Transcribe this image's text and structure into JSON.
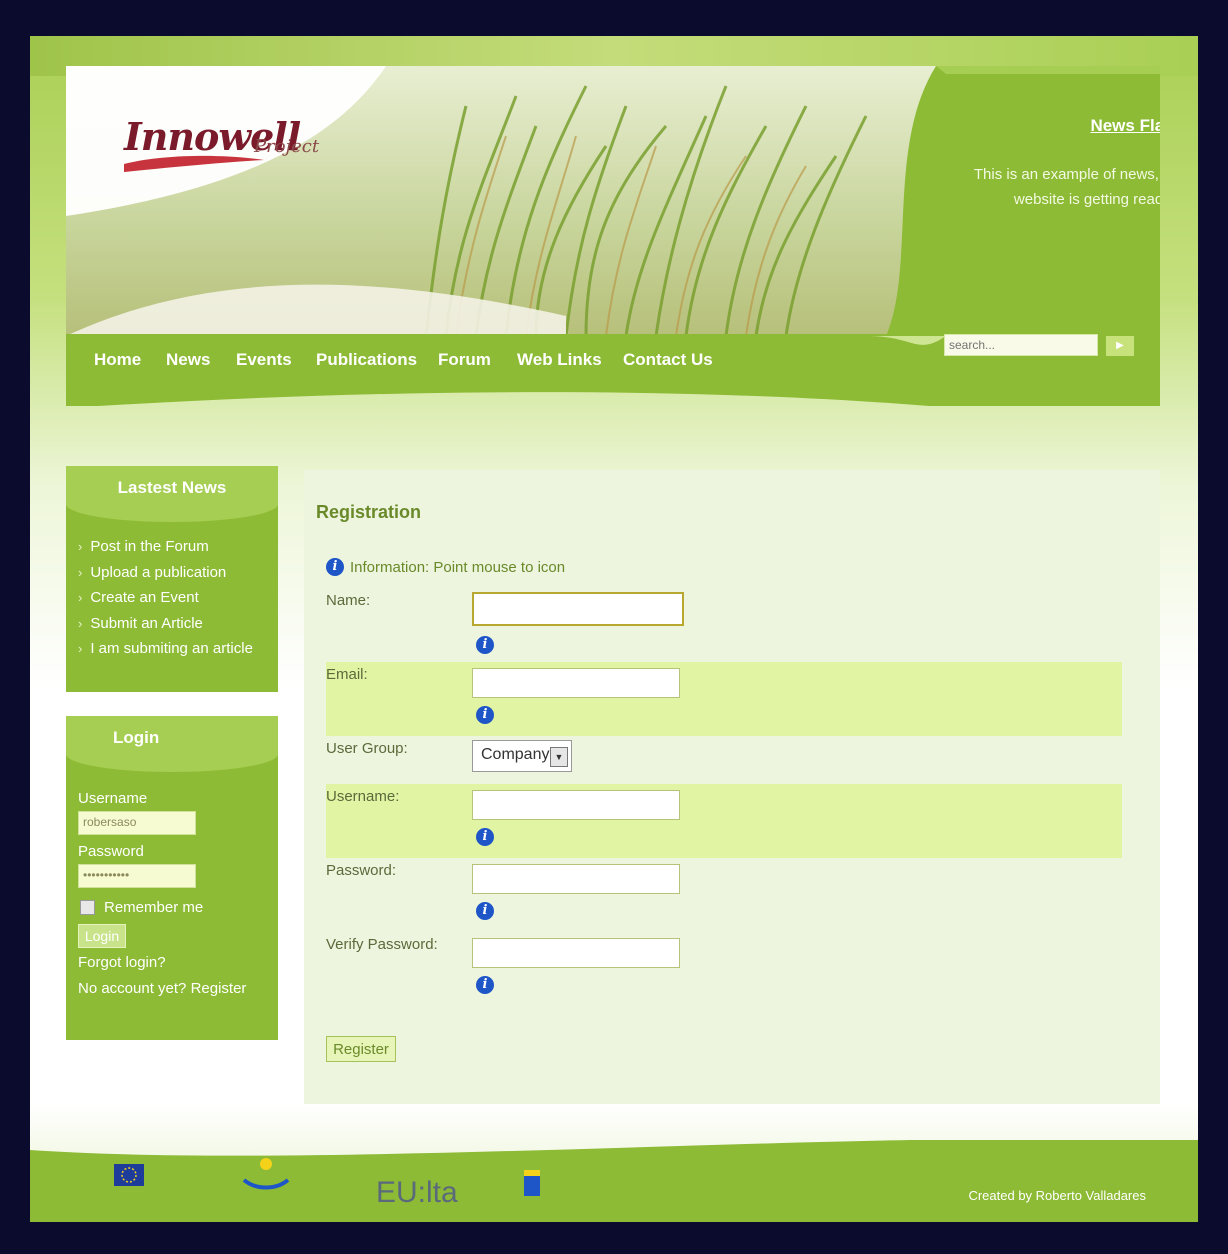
{
  "logo": {
    "main": "Innowell",
    "sub": "Project"
  },
  "news_flash": {
    "title": "News Flash",
    "text": "This is an example of news, the website is getting ready :)"
  },
  "search": {
    "placeholder": "search..."
  },
  "nav": [
    {
      "label": "Home"
    },
    {
      "label": "News"
    },
    {
      "label": "Events"
    },
    {
      "label": "Publications"
    },
    {
      "label": "Forum"
    },
    {
      "label": "Web Links"
    },
    {
      "label": "Contact Us"
    }
  ],
  "latest_news": {
    "title": "Lastest News",
    "items": [
      "Post in the Forum",
      "Upload a publication",
      "Create an Event",
      "Submit an Article",
      "I am submiting an article"
    ]
  },
  "login": {
    "title": "Login",
    "username_label": "Username",
    "username_value": "robersaso",
    "password_label": "Password",
    "password_value": "•••••••••••",
    "remember": "Remember me",
    "button": "Login",
    "forgot": "Forgot login?",
    "register": "No account yet? Register"
  },
  "registration": {
    "title": "Registration",
    "info": "Information: Point mouse to icon",
    "fields": {
      "name": "Name:",
      "email": "Email:",
      "user_group": "User Group:",
      "username": "Username:",
      "password": "Password:",
      "verify": "Verify Password:"
    },
    "user_group_value": "Company",
    "button": "Register"
  },
  "footer": {
    "eu_text": "EU:lta",
    "created_by": "Created by Roberto Valladares"
  },
  "colors": {
    "accent": "#8dbb35",
    "dark_frame": "#0b0b2e",
    "info_icon": "#1e56c8"
  }
}
